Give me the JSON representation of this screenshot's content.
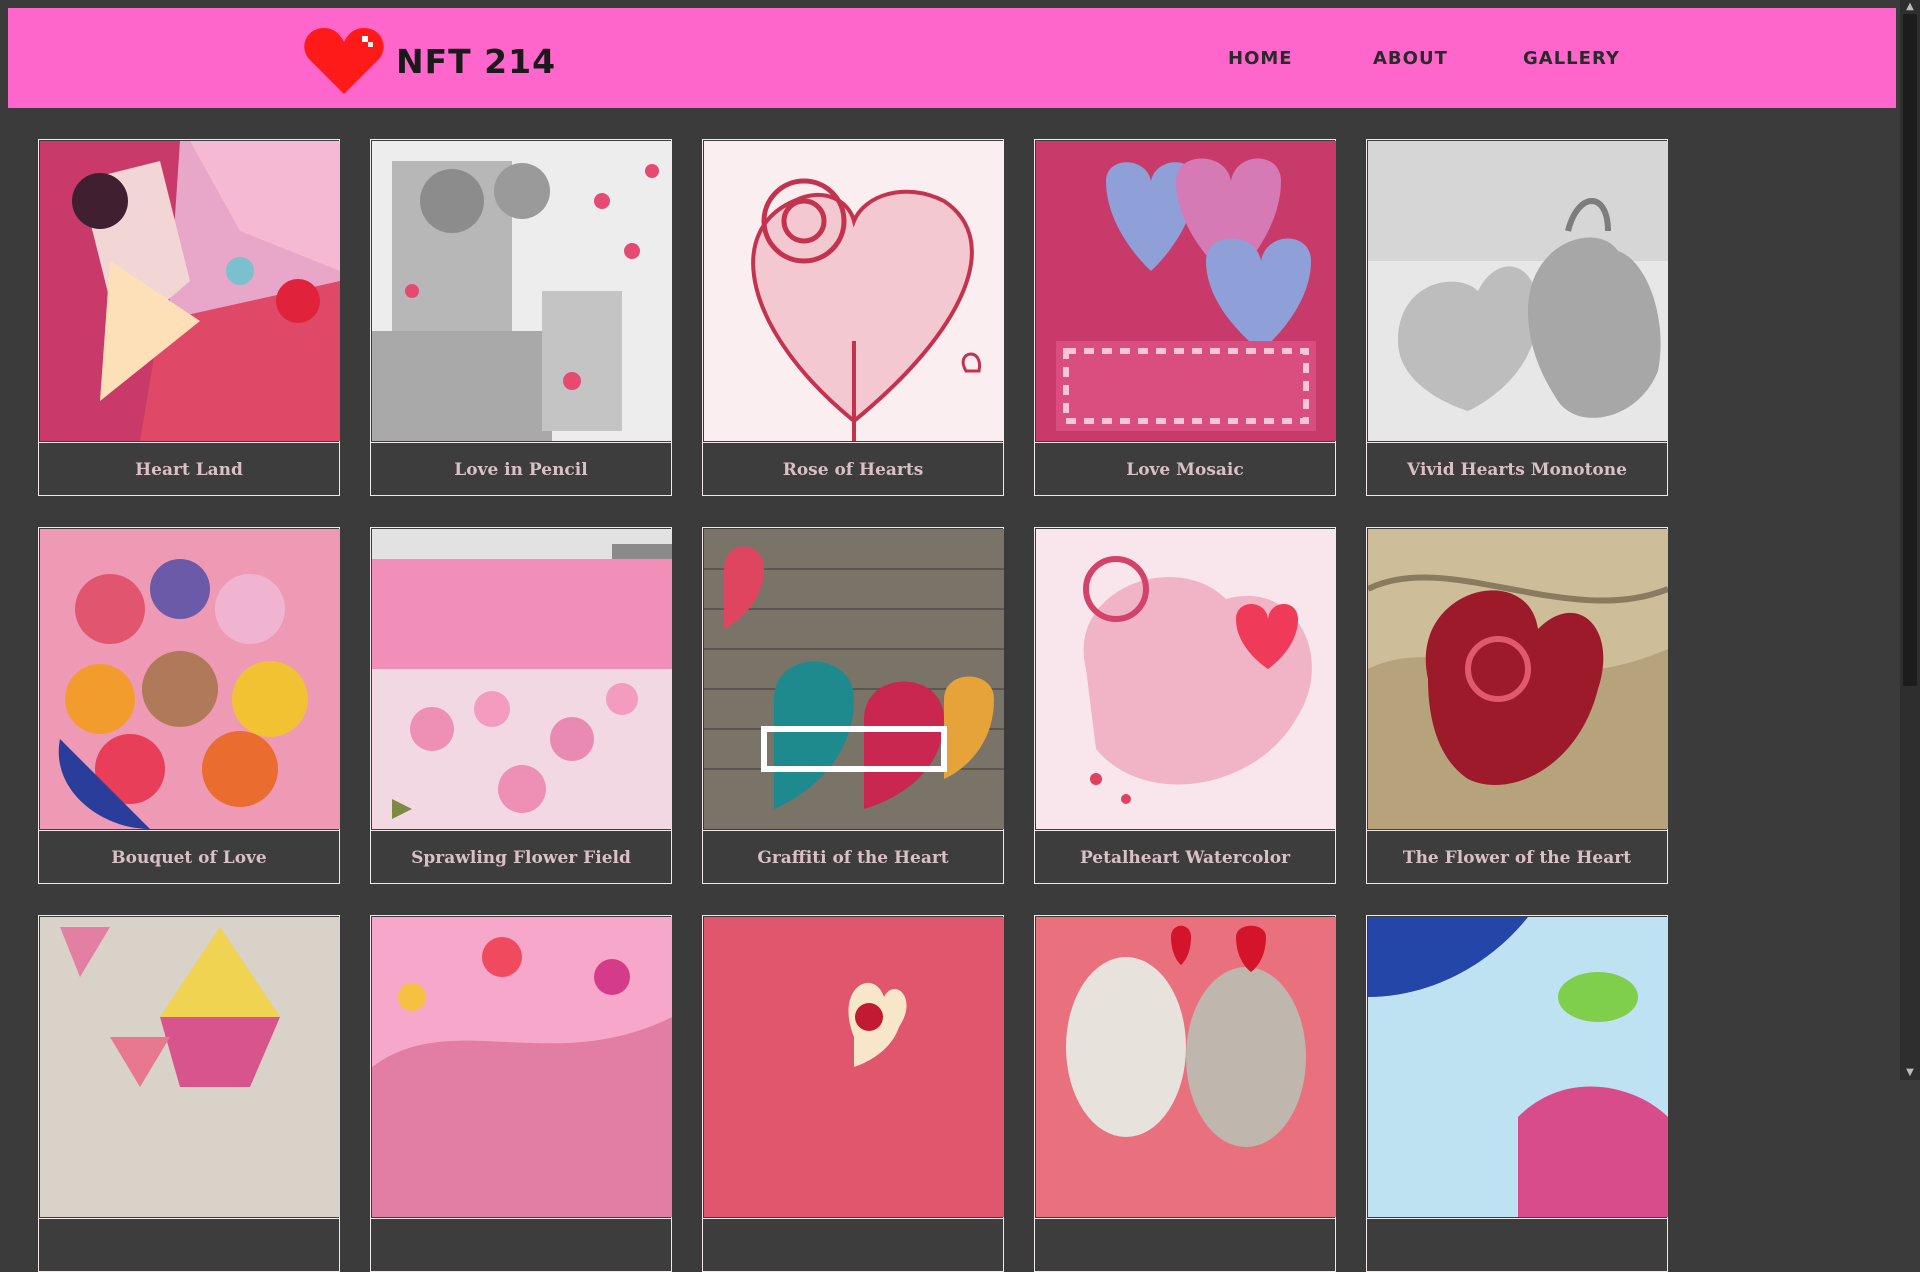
{
  "site": {
    "title": "NFT 214",
    "logo_icon": "heart-icon"
  },
  "nav": {
    "items": [
      "HOME",
      "ABOUT",
      "GALLERY"
    ]
  },
  "colors": {
    "header": "#ff66cc",
    "background": "#3b3b3b",
    "caption_text": "#d9c0c6"
  },
  "gallery": {
    "items": [
      {
        "title": "Heart Land"
      },
      {
        "title": "Love in Pencil"
      },
      {
        "title": "Rose of Hearts"
      },
      {
        "title": "Love Mosaic"
      },
      {
        "title": "Vivid Hearts Monotone"
      },
      {
        "title": "Bouquet of Love"
      },
      {
        "title": "Sprawling Flower Field"
      },
      {
        "title": "Graffiti of the Heart"
      },
      {
        "title": "Petalheart Watercolor"
      },
      {
        "title": "The Flower of the Heart"
      },
      {
        "title": ""
      },
      {
        "title": ""
      },
      {
        "title": ""
      },
      {
        "title": ""
      },
      {
        "title": ""
      }
    ]
  }
}
